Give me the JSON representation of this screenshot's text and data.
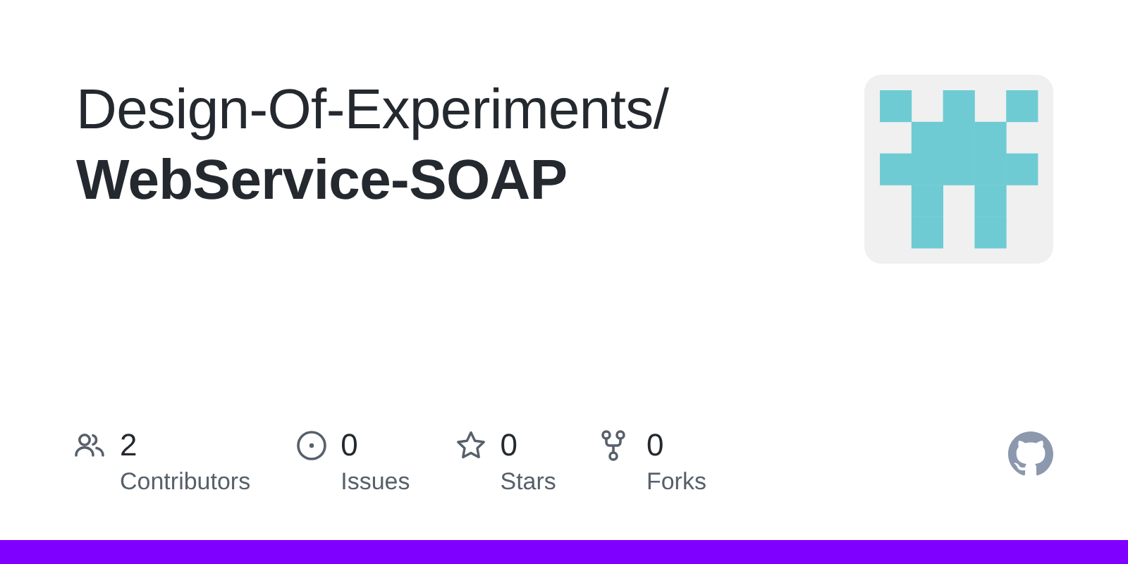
{
  "repository": {
    "owner": "Design-Of-Experiments/",
    "name": "WebService-SOAP"
  },
  "stats": [
    {
      "kind": "contributors",
      "count": "2",
      "label": "Contributors"
    },
    {
      "kind": "issues",
      "count": "0",
      "label": "Issues"
    },
    {
      "kind": "stars",
      "count": "0",
      "label": "Stars"
    },
    {
      "kind": "forks",
      "count": "0",
      "label": "Forks"
    }
  ]
}
